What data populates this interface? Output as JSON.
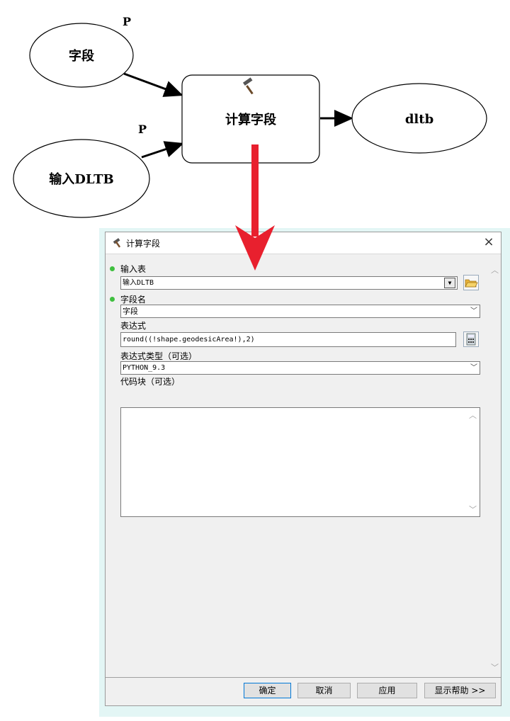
{
  "model": {
    "field_node": "字段",
    "input_node": "输入DLTB",
    "tool_node": "计算字段",
    "output_node": "dltb",
    "param_mark_1": "P",
    "param_mark_2": "P"
  },
  "dialog": {
    "title": "计算字段",
    "close": "×",
    "input_table": {
      "label": "输入表",
      "value": "输入DLTB"
    },
    "field_name": {
      "label": "字段名",
      "value": "字段"
    },
    "expression": {
      "label": "表达式",
      "value": "round((!shape.geodesicArea!),2)"
    },
    "expression_type": {
      "label": "表达式类型（可选）",
      "value": "PYTHON_9.3"
    },
    "code_block": {
      "label": "代码块（可选）",
      "value": ""
    },
    "buttons": {
      "ok": "确定",
      "cancel": "取消",
      "apply": "应用",
      "help": "显示帮助 >>"
    }
  },
  "colors": {
    "arrow_red": "#e8202e",
    "required_dot": "#3fbf3f",
    "dialog_bg": "#f0f0f0"
  }
}
